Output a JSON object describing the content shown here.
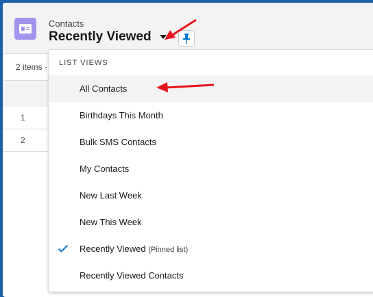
{
  "header": {
    "object_label": "Contacts",
    "view_title": "Recently Viewed",
    "icon": "contact-card-icon",
    "pin_icon": "pin-icon"
  },
  "list": {
    "items_info": "2 items ·",
    "rows": [
      "1",
      "2"
    ]
  },
  "dropdown": {
    "section_title": "LIST VIEWS",
    "items": [
      {
        "label": "All Contacts",
        "note": "",
        "selected": false
      },
      {
        "label": "Birthdays This Month",
        "note": "",
        "selected": false
      },
      {
        "label": "Bulk SMS Contacts",
        "note": "",
        "selected": false
      },
      {
        "label": "My Contacts",
        "note": "",
        "selected": false
      },
      {
        "label": "New Last Week",
        "note": "",
        "selected": false
      },
      {
        "label": "New This Week",
        "note": "",
        "selected": false
      },
      {
        "label": "Recently Viewed",
        "note": "(Pinned list)",
        "selected": true
      },
      {
        "label": "Recently Viewed Contacts",
        "note": "",
        "selected": false
      }
    ]
  },
  "colors": {
    "background": "#1b5fa8",
    "icon_bg": "#a094ed",
    "accent": "#0176d3",
    "annotation_arrow": "#e8141b"
  }
}
